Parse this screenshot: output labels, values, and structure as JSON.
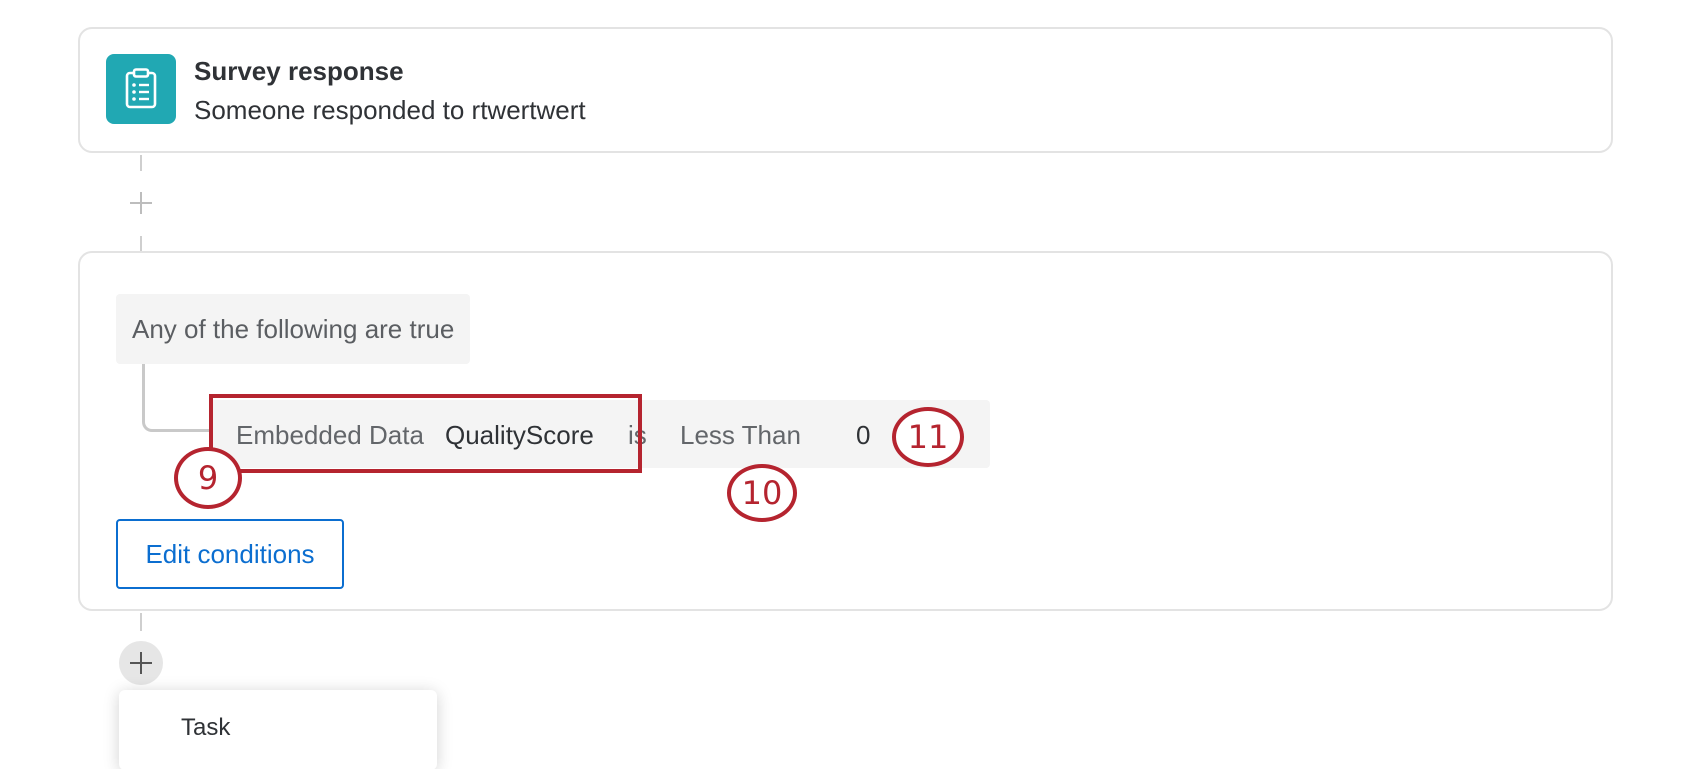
{
  "trigger": {
    "icon": "clipboard-list-icon",
    "title": "Survey response",
    "subtitle": "Someone responded to rtwertwert",
    "icon_bg": "#21a8b3"
  },
  "condition": {
    "group_label": "Any of the following are true",
    "row": {
      "field_type": "Embedded Data",
      "field_name": "QualityScore",
      "operator_word": "is",
      "operator": "Less Than",
      "value": "0"
    },
    "edit_label": "Edit conditions"
  },
  "callouts": [
    "9",
    "10",
    "11"
  ],
  "menu": {
    "items": [
      {
        "label": "Task"
      }
    ]
  },
  "colors": {
    "accent": "#0b6ed0",
    "callout": "#b5242f",
    "border": "#e3e3e3"
  }
}
